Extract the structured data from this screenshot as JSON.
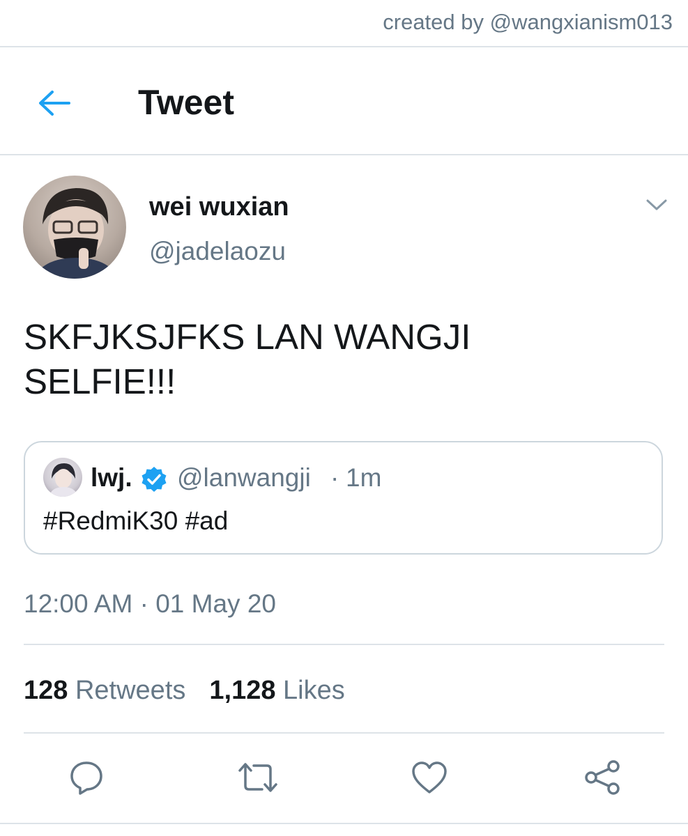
{
  "credit": "created by @wangxianism013",
  "header": {
    "title": "Tweet",
    "back_icon": "arrow-left-icon",
    "accent": "#1da1f2"
  },
  "tweet": {
    "author": {
      "display_name": "wei wuxian",
      "handle": "@jadelaozu"
    },
    "text_line1": "SKFJKSJFKS LAN WANGJI",
    "text_line2": "SELFIE!!!",
    "quoted": {
      "display_name": "lwj.",
      "verified": true,
      "handle": "@lanwangji",
      "separator": "·",
      "time": "1m",
      "text": "#RedmiK30 #ad"
    },
    "timestamp": "12:00 AM · 01 May 20",
    "stats": {
      "retweets_count": "128",
      "retweets_label": "Retweets",
      "likes_count": "1,128",
      "likes_label": "Likes"
    },
    "actions": [
      "reply-icon",
      "retweet-icon",
      "like-icon",
      "share-icon"
    ]
  }
}
